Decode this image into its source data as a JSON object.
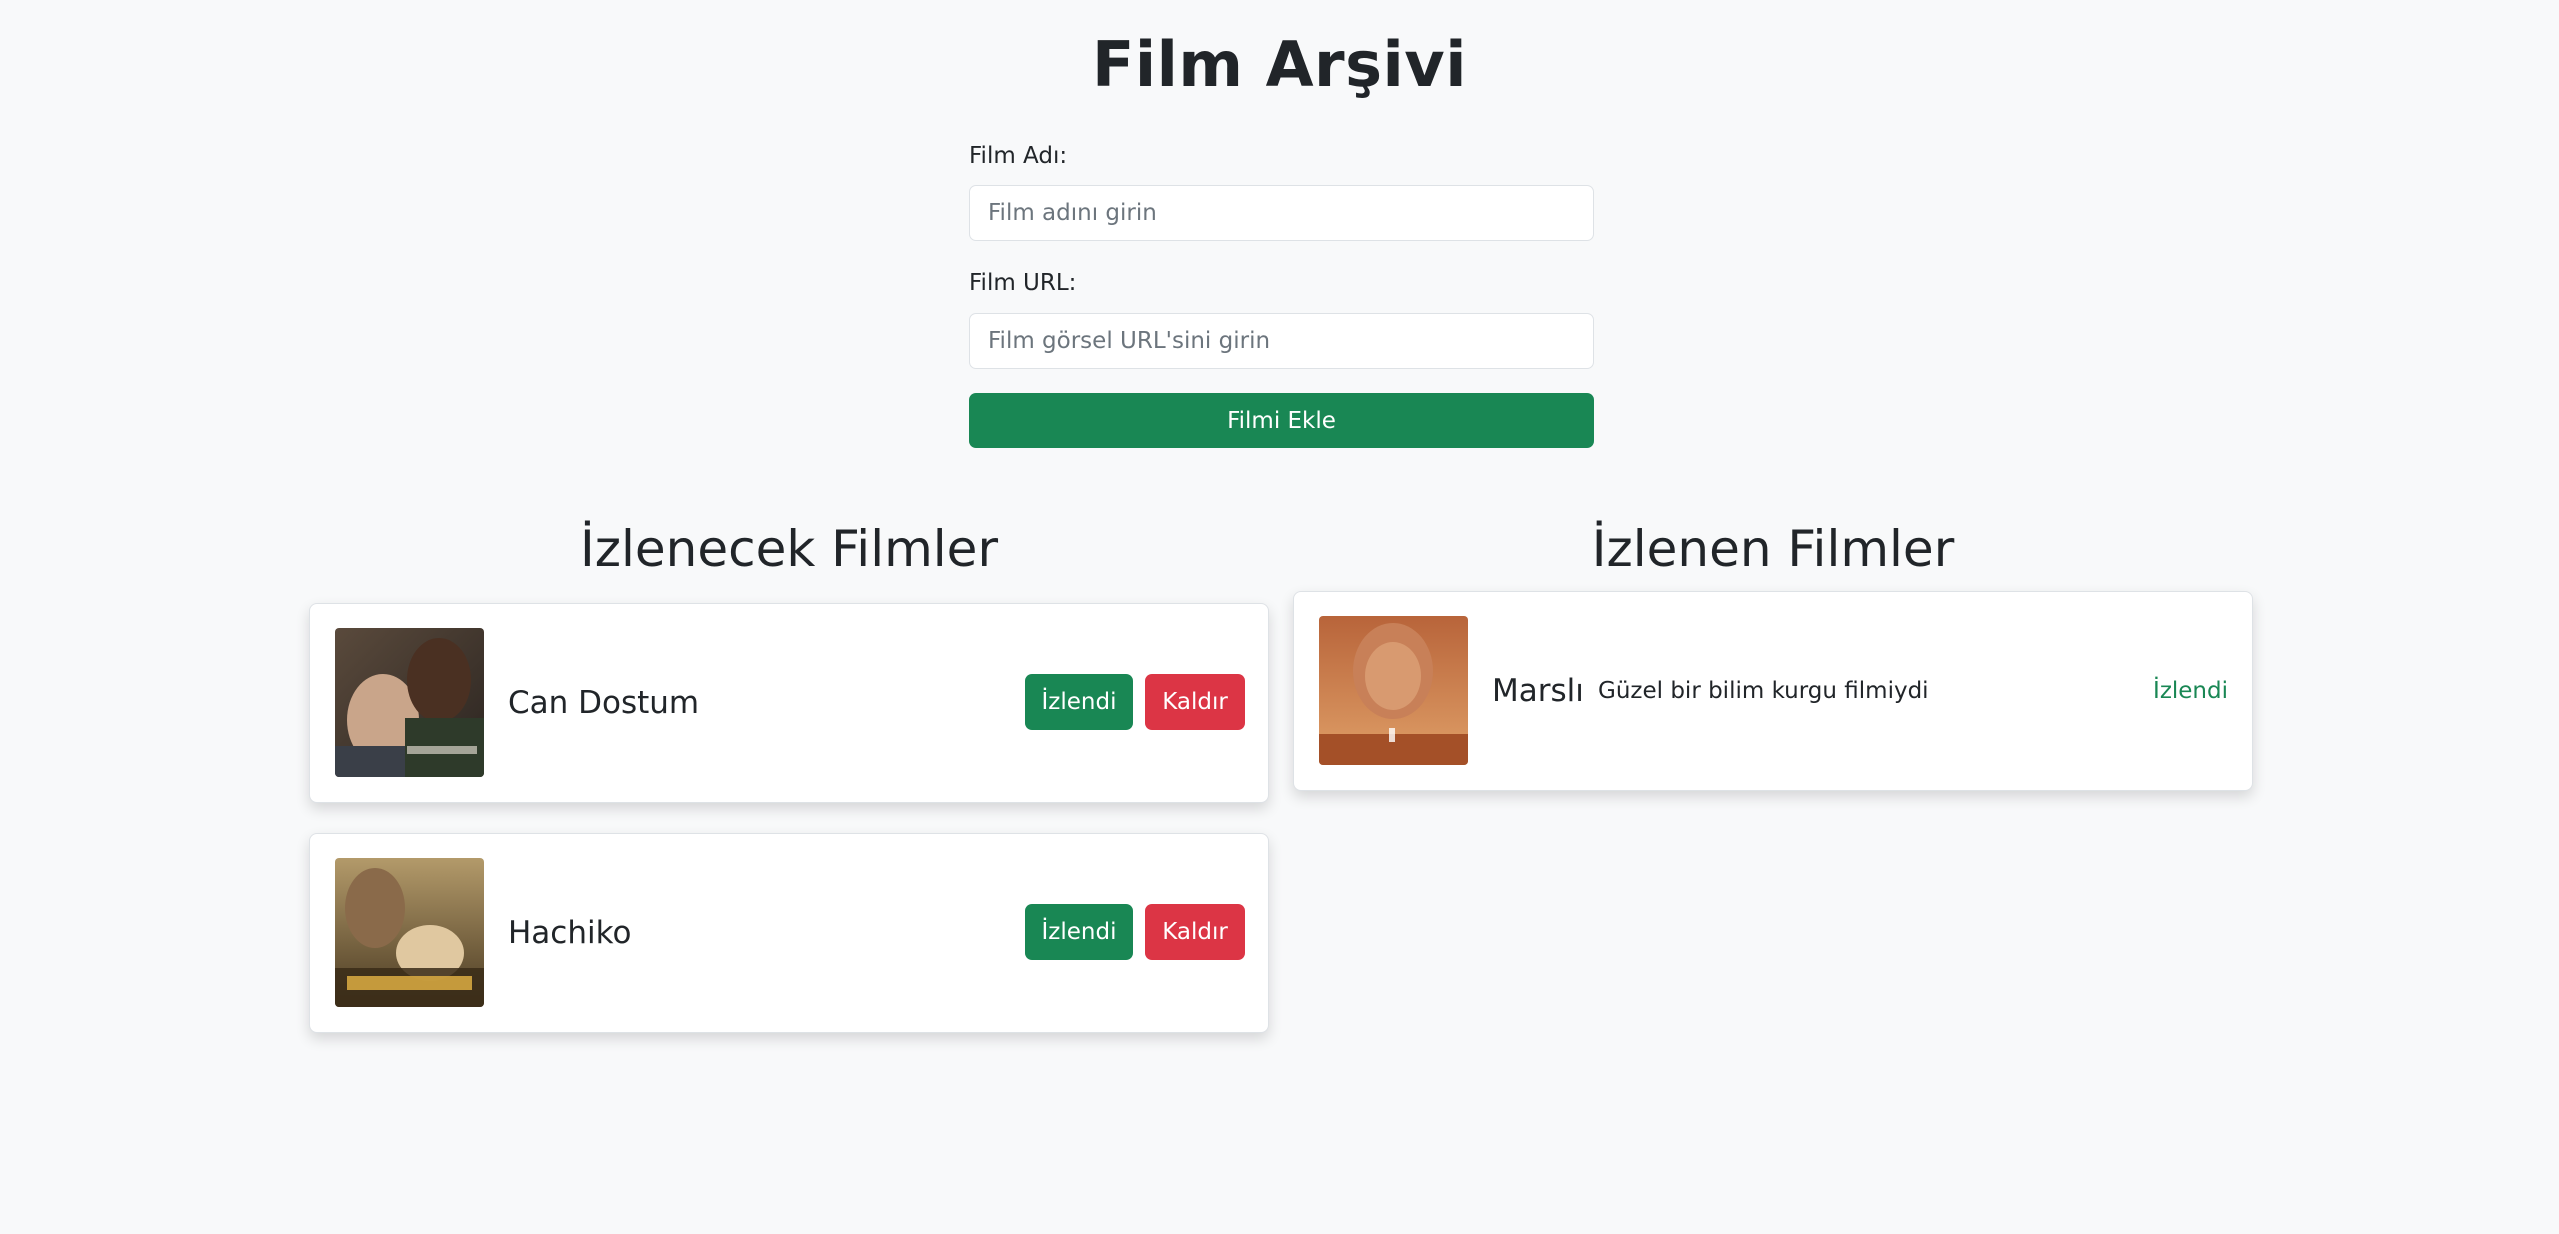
{
  "page": {
    "title": "Film Arşivi"
  },
  "form": {
    "name_label": "Film Adı:",
    "name_placeholder": "Film adını girin",
    "url_label": "Film URL:",
    "url_placeholder": "Film görsel URL'sini girin",
    "submit_label": "Filmi Ekle"
  },
  "to_watch": {
    "title": "İzlenecek Filmler",
    "items": [
      {
        "name": "Can Dostum",
        "watched_label": "İzlendi",
        "remove_label": "Kaldır"
      },
      {
        "name": "Hachiko",
        "watched_label": "İzlendi",
        "remove_label": "Kaldır"
      }
    ]
  },
  "watched": {
    "title": "İzlenen Filmler",
    "items": [
      {
        "name": "Marslı",
        "note": "Güzel bir bilim kurgu filmiydi",
        "status_label": "İzlendi"
      }
    ]
  },
  "colors": {
    "success": "#198754",
    "danger": "#dc3545",
    "background": "#f8f9fa"
  }
}
